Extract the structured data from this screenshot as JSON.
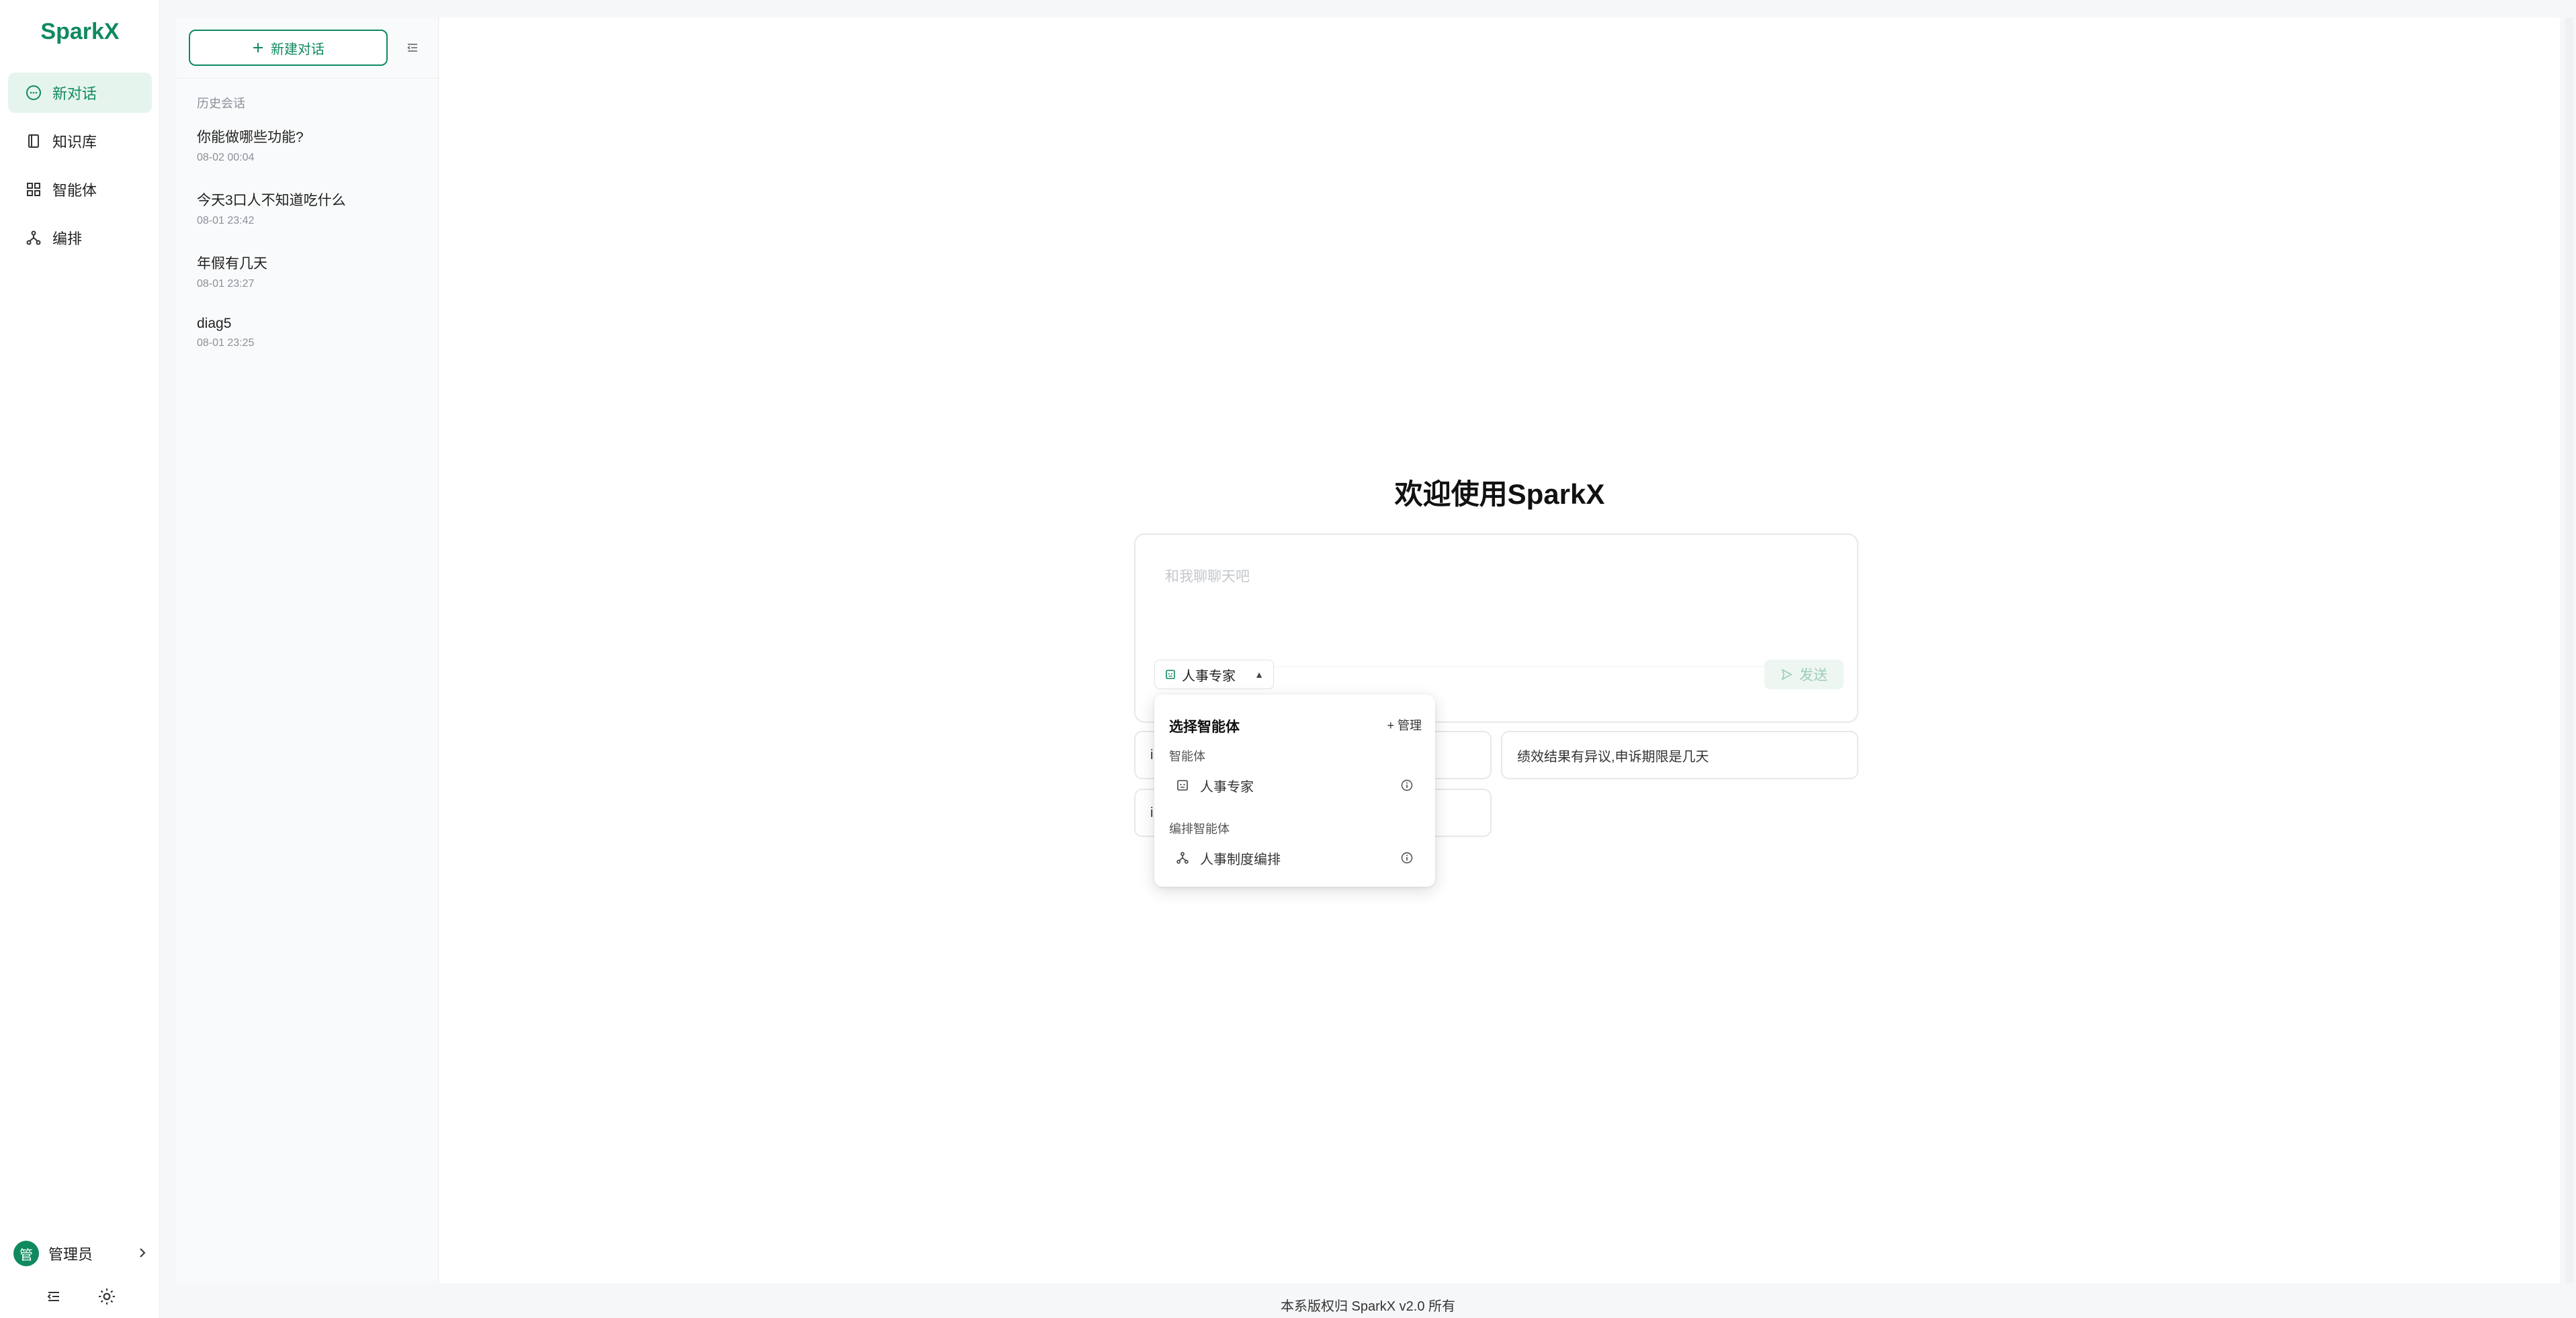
{
  "app": {
    "brand": "SparkX"
  },
  "nav": {
    "items": [
      {
        "label": "新对话",
        "icon": "chat-bubble-icon",
        "active": true
      },
      {
        "label": "知识库",
        "icon": "book-icon",
        "active": false
      },
      {
        "label": "智能体",
        "icon": "grid-icon",
        "active": false
      },
      {
        "label": "编排",
        "icon": "workflow-icon",
        "active": false
      }
    ],
    "user": {
      "avatar_char": "管",
      "name": "管理员"
    },
    "bottom_icons": [
      "menu-fold-icon",
      "sun-icon"
    ]
  },
  "history": {
    "new_chat_label": "新建对话",
    "section_label": "历史会话",
    "conversations": [
      {
        "title": "你能做哪些功能?",
        "time": "08-02 00:04"
      },
      {
        "title": "今天3口人不知道吃什么",
        "time": "08-01 23:42"
      },
      {
        "title": "年假有几天",
        "time": "08-01 23:27"
      },
      {
        "title": "diag5",
        "time": "08-01 23:25"
      }
    ]
  },
  "main": {
    "welcome": "欢迎使用SparkX",
    "input_placeholder": "和我聊聊天吧",
    "selected_agent": "人事专家",
    "send_label": "发送",
    "suggestions": [
      {
        "text": "i"
      },
      {
        "text": "绩效结果有异议,申诉期限是几天"
      },
      {
        "text": "i"
      }
    ]
  },
  "dropdown": {
    "title": "选择智能体",
    "manage_label": "+ 管理",
    "groups": [
      {
        "label": "智能体",
        "items": [
          {
            "label": "人事专家",
            "icon": "robot-icon"
          }
        ]
      },
      {
        "label": "编排智能体",
        "items": [
          {
            "label": "人事制度编排",
            "icon": "workflow-icon"
          }
        ]
      }
    ]
  },
  "footer": {
    "text": "本系版权归 SparkX v2.0 所有"
  },
  "colors": {
    "brand": "#0f8a5f",
    "active_bg": "#e6f4ee"
  }
}
